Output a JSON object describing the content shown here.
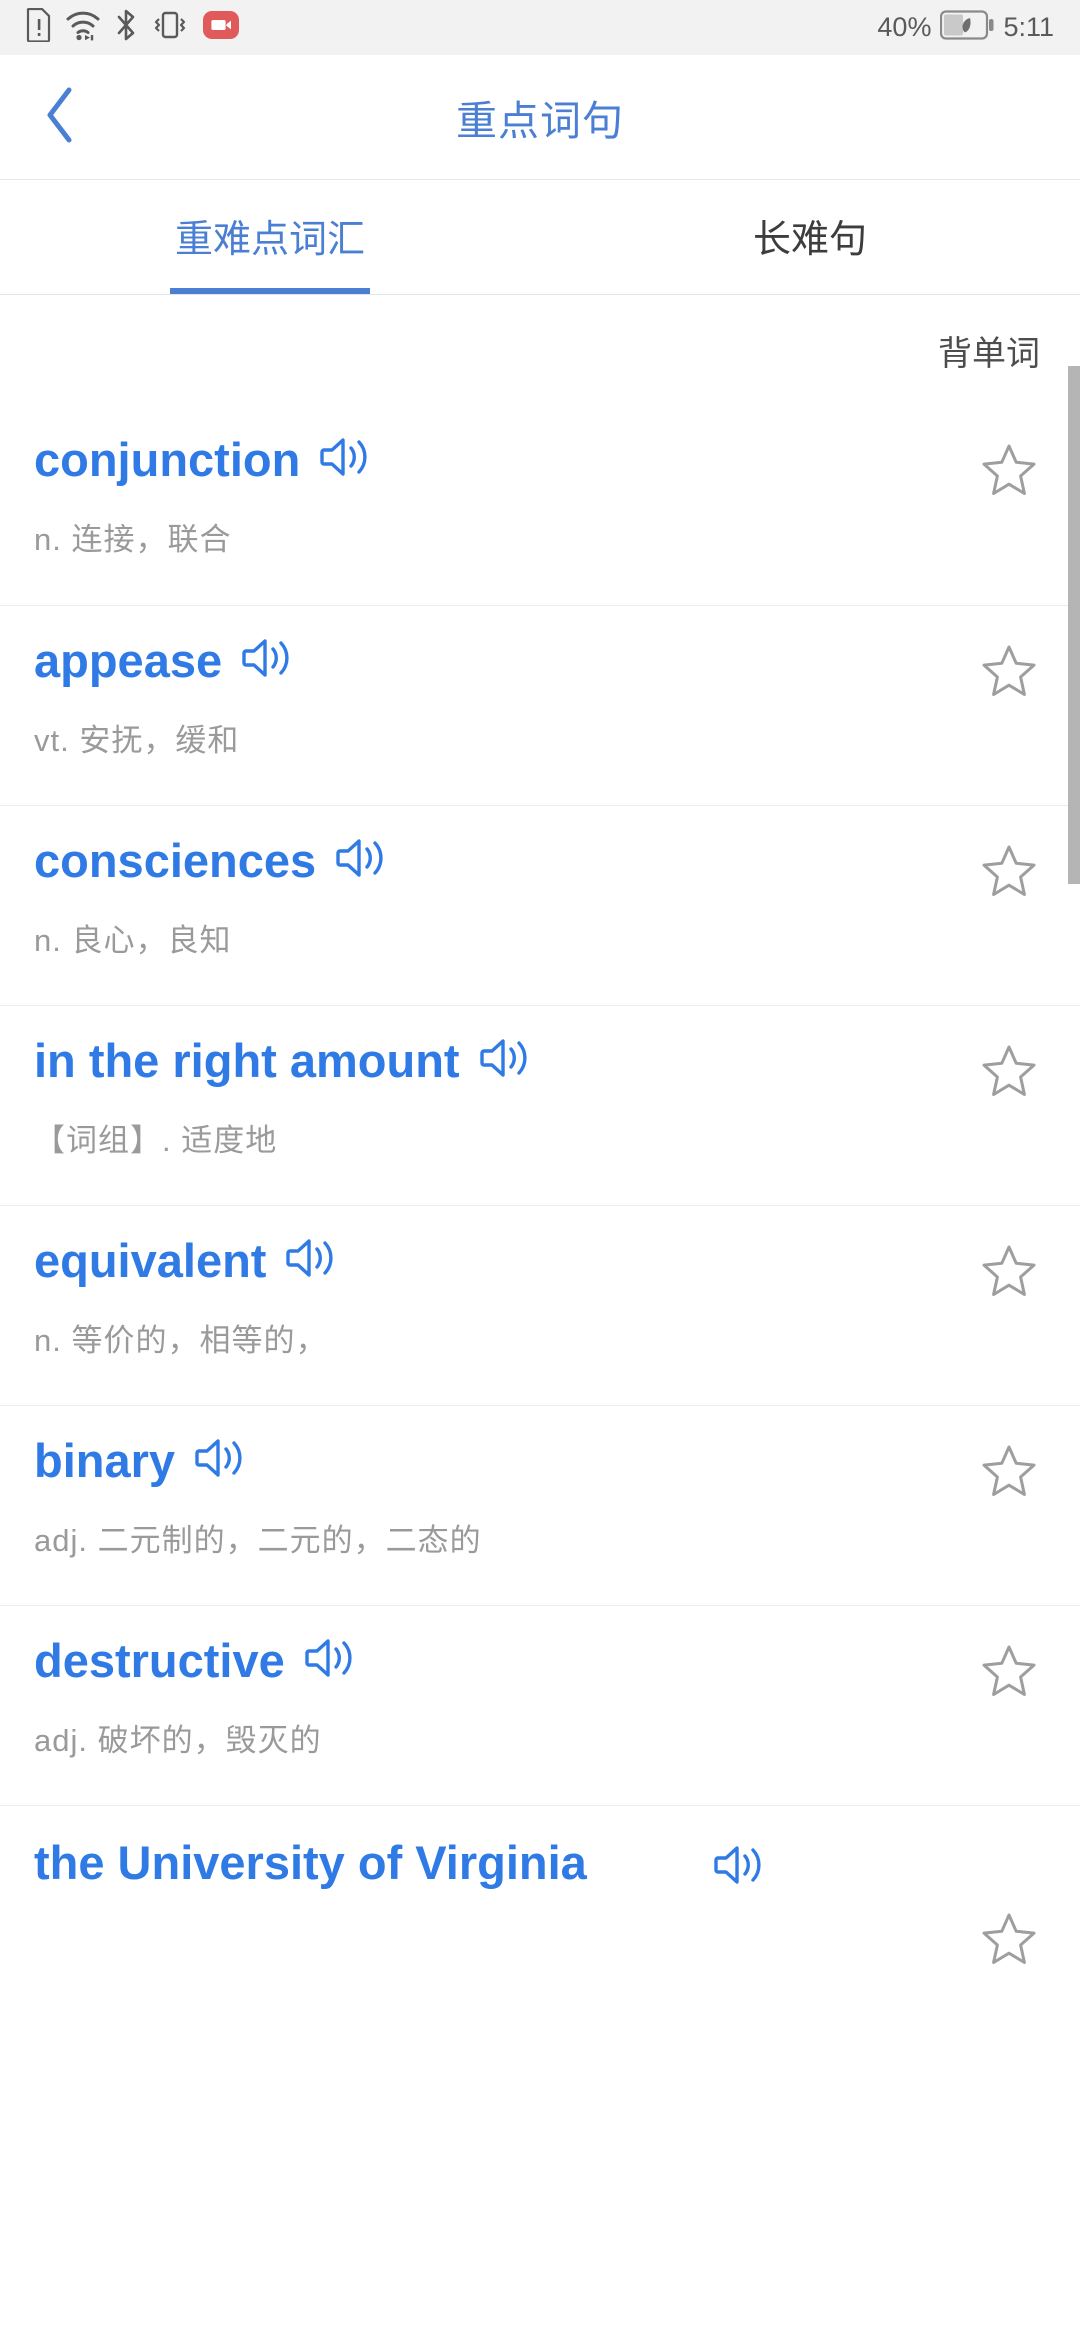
{
  "statusbar": {
    "icons": [
      "sim-alert-icon",
      "wifi-icon",
      "bluetooth-icon",
      "vibrate-icon",
      "screen-record-icon"
    ],
    "battery_percent": "40%",
    "battery_icon": "battery-saver-icon",
    "time": "5:11"
  },
  "titlebar": {
    "back_icon": "back-chevron-icon",
    "title": "重点词句",
    "accent_color": "#4a7fd4"
  },
  "tabs": [
    {
      "label": "重难点词汇",
      "active": true
    },
    {
      "label": "长难句",
      "active": false
    }
  ],
  "toolbar": {
    "memorize_label": "背单词"
  },
  "words": [
    {
      "term": "conjunction",
      "definition": "n. 连接，联合",
      "speaker_icon": "speaker-icon",
      "star_icon": "star-outline-icon",
      "starred": false,
      "wide": false
    },
    {
      "term": "appease",
      "definition": "vt. 安抚，缓和",
      "speaker_icon": "speaker-icon",
      "star_icon": "star-outline-icon",
      "starred": false,
      "wide": false
    },
    {
      "term": "consciences",
      "definition": "n. 良心，良知",
      "speaker_icon": "speaker-icon",
      "star_icon": "star-outline-icon",
      "starred": false,
      "wide": false
    },
    {
      "term": "in the right amount",
      "definition": "【词组】. 适度地",
      "speaker_icon": "speaker-icon",
      "star_icon": "star-outline-icon",
      "starred": false,
      "wide": false
    },
    {
      "term": "equivalent",
      "definition": "n. 等价的，相等的，",
      "speaker_icon": "speaker-icon",
      "star_icon": "star-outline-icon",
      "starred": false,
      "wide": false
    },
    {
      "term": "binary",
      "definition": "adj. 二元制的，二元的，二态的",
      "speaker_icon": "speaker-icon",
      "star_icon": "star-outline-icon",
      "starred": false,
      "wide": false
    },
    {
      "term": "destructive",
      "definition": "adj. 破坏的，毁灭的",
      "speaker_icon": "speaker-icon",
      "star_icon": "star-outline-icon",
      "starred": false,
      "wide": false
    },
    {
      "term": "the University of Virginia",
      "definition": "",
      "speaker_icon": "speaker-icon",
      "star_icon": "star-outline-icon",
      "starred": false,
      "wide": true
    }
  ],
  "colors": {
    "accent_blue": "#2f7ae5",
    "title_blue": "#4a7fd4",
    "definition_gray": "#9a9a9a",
    "star_gray": "#9e9e9e",
    "statusbar_bg": "#f2f2f2",
    "scrollbar": "#b5b5b5"
  }
}
